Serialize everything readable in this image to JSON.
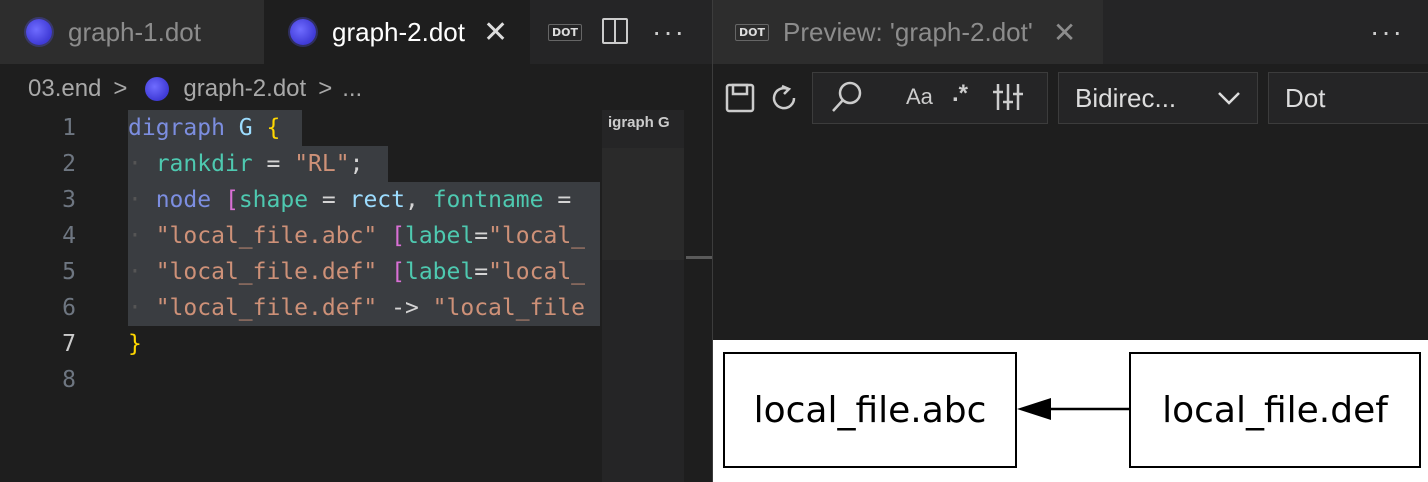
{
  "left": {
    "tabs": [
      {
        "label": "graph-1.dot"
      },
      {
        "label": "graph-2.dot",
        "close": "✕"
      }
    ],
    "actions": {
      "dot_badge": "DOT",
      "more": "···"
    },
    "breadcrumb": {
      "folder": "03.end",
      "sep1": ">",
      "file": "graph-2.dot",
      "sep2": ">",
      "ellipsis": "..."
    },
    "line_numbers": [
      "1",
      "2",
      "3",
      "4",
      "5",
      "6",
      "7",
      "8"
    ],
    "minimap_text": "igraph G"
  },
  "preview": {
    "tab_badge": "DOT",
    "tab_label": "Preview: 'graph-2.dot'",
    "tab_close": "✕",
    "more": "···",
    "toolbar": {
      "case_label": "Aa",
      "regex_label": ".*",
      "direction_select": "Bidirec...",
      "direction_chevron": "⌄",
      "engine_select": "Dot"
    },
    "graph": {
      "nodes": [
        {
          "label": "local_file.abc"
        },
        {
          "label": "local_file.def"
        }
      ],
      "edge": {
        "from": "local_file.def",
        "to": "local_file.abc"
      }
    }
  },
  "colors": {
    "orb": "#4b45e0",
    "keyword": "#7c8ee0",
    "string": "#ce9178",
    "attribute": "#4ec9b0",
    "bracket_yellow": "#ffd700",
    "bracket_magenta": "#da70d6"
  },
  "code_tokens": {
    "l1": [
      "digraph",
      " ",
      "G",
      " ",
      "{"
    ],
    "l2": [
      "rankdir",
      " = ",
      "\"RL\"",
      ";"
    ],
    "l3": [
      "node",
      " ",
      "[",
      "shape",
      " = ",
      "rect",
      ", ",
      "fontname",
      " ="
    ],
    "l4": [
      "\"local_file.abc\"",
      " ",
      "[",
      "label",
      "=",
      "\"local_"
    ],
    "l5": [
      "\"local_file.def\"",
      " ",
      "[",
      "label",
      "=",
      "\"local_"
    ],
    "l6": [
      "\"local_file.def\"",
      " -> ",
      "\"local_file"
    ],
    "l7": [
      "}"
    ]
  }
}
